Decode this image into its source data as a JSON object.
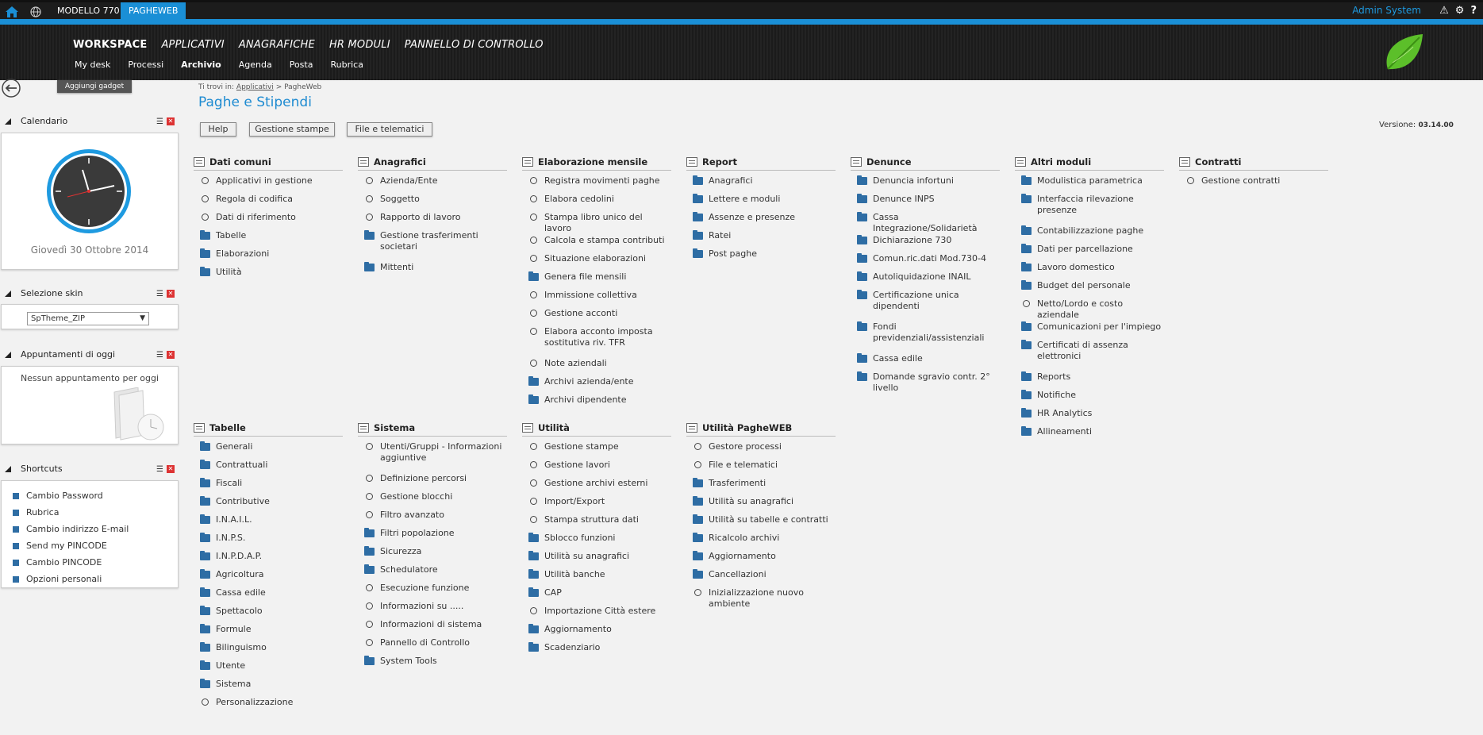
{
  "topbar": {
    "tabs": [
      "MODELLO 770",
      "PAGHEWEB"
    ],
    "user": "Admin System",
    "icons": [
      "home-icon",
      "globe-icon",
      "warning-icon",
      "gear-icon",
      "help-icon"
    ]
  },
  "header": {
    "main_nav": [
      "WORKSPACE",
      "APPLICATIVI",
      "ANAGRAFICHE",
      "HR MODULI",
      "PANNELLO DI CONTROLLO"
    ],
    "sub_nav": [
      "My desk",
      "Processi",
      "Archivio",
      "Agenda",
      "Posta",
      "Rubrica"
    ]
  },
  "sidebar": {
    "add_gadget": "Aggiungi gadget",
    "calendar": {
      "title": "Calendario",
      "date": "Giovedì 30 Ottobre 2014"
    },
    "skin": {
      "title": "Selezione skin",
      "selected": "SpTheme_ZIP"
    },
    "appointments": {
      "title": "Appuntamenti di oggi",
      "empty": "Nessun appuntamento per oggi"
    },
    "shortcuts": {
      "title": "Shortcuts",
      "items": [
        "Cambio Password",
        "Rubrica",
        "Cambio indirizzo E-mail",
        "Send my PINCODE",
        "Cambio PINCODE",
        "Opzioni personali"
      ]
    }
  },
  "main": {
    "breadcrumb": {
      "prefix": "Ti trovi in:",
      "link": "Applicativi",
      "sep": ">",
      "current": "PagheWeb"
    },
    "title": "Paghe e Stipendi",
    "buttons": [
      "Help",
      "Gestione stampe",
      "File e telematici"
    ],
    "version_label": "Versione:",
    "version": "03.14.00",
    "sections_top": [
      {
        "title": "Dati comuni",
        "items": [
          {
            "t": "Applicativi in gestione",
            "k": "c"
          },
          {
            "t": "Regola di codifica",
            "k": "c"
          },
          {
            "t": "Dati di riferimento",
            "k": "c"
          },
          {
            "t": "Tabelle",
            "k": "f"
          },
          {
            "t": "Elaborazioni",
            "k": "f"
          },
          {
            "t": "Utilità",
            "k": "f"
          }
        ]
      },
      {
        "title": "Anagrafici",
        "items": [
          {
            "t": "Azienda/Ente",
            "k": "c"
          },
          {
            "t": "Soggetto",
            "k": "c"
          },
          {
            "t": "Rapporto di lavoro",
            "k": "c"
          },
          {
            "t": "Gestione trasferimenti societari",
            "k": "f"
          },
          {
            "t": "Mittenti",
            "k": "f"
          }
        ]
      },
      {
        "title": "Elaborazione mensile",
        "items": [
          {
            "t": "Registra movimenti paghe",
            "k": "c"
          },
          {
            "t": "Elabora cedolini",
            "k": "c"
          },
          {
            "t": "Stampa libro unico del lavoro",
            "k": "c"
          },
          {
            "t": "Calcola e stampa contributi",
            "k": "c"
          },
          {
            "t": "Situazione elaborazioni",
            "k": "c"
          },
          {
            "t": "Genera file mensili",
            "k": "f"
          },
          {
            "t": "Immissione collettiva",
            "k": "c"
          },
          {
            "t": "Gestione acconti",
            "k": "c"
          },
          {
            "t": "Elabora acconto imposta sostitutiva riv. TFR",
            "k": "c"
          },
          {
            "t": "Note aziendali",
            "k": "c"
          },
          {
            "t": "Archivi azienda/ente",
            "k": "f"
          },
          {
            "t": "Archivi dipendente",
            "k": "f"
          }
        ]
      },
      {
        "title": "Report",
        "items": [
          {
            "t": "Anagrafici",
            "k": "f"
          },
          {
            "t": "Lettere e moduli",
            "k": "f"
          },
          {
            "t": "Assenze e presenze",
            "k": "f"
          },
          {
            "t": "Ratei",
            "k": "f"
          },
          {
            "t": "Post paghe",
            "k": "f"
          }
        ]
      },
      {
        "title": "Denunce",
        "items": [
          {
            "t": "Denuncia infortuni",
            "k": "f"
          },
          {
            "t": "Denunce INPS",
            "k": "f"
          },
          {
            "t": "Cassa Integrazione/Solidarietà",
            "k": "f"
          },
          {
            "t": "Dichiarazione 730",
            "k": "f"
          },
          {
            "t": "Comun.ric.dati Mod.730-4",
            "k": "f"
          },
          {
            "t": "Autoliquidazione INAIL",
            "k": "f"
          },
          {
            "t": "Certificazione unica dipendenti",
            "k": "f"
          },
          {
            "t": "Fondi previdenziali/assistenziali",
            "k": "f"
          },
          {
            "t": "Cassa edile",
            "k": "f"
          },
          {
            "t": "Domande sgravio contr. 2° livello",
            "k": "f"
          }
        ]
      },
      {
        "title": "Altri moduli",
        "items": [
          {
            "t": "Modulistica parametrica",
            "k": "f"
          },
          {
            "t": "Interfaccia rilevazione presenze",
            "k": "f"
          },
          {
            "t": "Contabilizzazione paghe",
            "k": "f"
          },
          {
            "t": "Dati per parcellazione",
            "k": "f"
          },
          {
            "t": "Lavoro domestico",
            "k": "f"
          },
          {
            "t": "Budget del personale",
            "k": "f"
          },
          {
            "t": "Netto/Lordo e costo aziendale",
            "k": "c"
          },
          {
            "t": "Comunicazioni per l'impiego",
            "k": "f"
          },
          {
            "t": "Certificati di assenza elettronici",
            "k": "f"
          },
          {
            "t": "Reports",
            "k": "f"
          },
          {
            "t": "Notifiche",
            "k": "f"
          },
          {
            "t": "HR Analytics",
            "k": "f"
          },
          {
            "t": "Allineamenti",
            "k": "f"
          }
        ]
      },
      {
        "title": "Contratti",
        "items": [
          {
            "t": "Gestione contratti",
            "k": "c"
          }
        ]
      }
    ],
    "sections_bottom": [
      {
        "title": "Tabelle",
        "items": [
          {
            "t": "Generali",
            "k": "f"
          },
          {
            "t": "Contrattuali",
            "k": "f"
          },
          {
            "t": "Fiscali",
            "k": "f"
          },
          {
            "t": "Contributive",
            "k": "f"
          },
          {
            "t": "I.N.A.I.L.",
            "k": "f"
          },
          {
            "t": "I.N.P.S.",
            "k": "f"
          },
          {
            "t": "I.N.P.D.A.P.",
            "k": "f"
          },
          {
            "t": "Agricoltura",
            "k": "f"
          },
          {
            "t": "Cassa edile",
            "k": "f"
          },
          {
            "t": "Spettacolo",
            "k": "f"
          },
          {
            "t": "Formule",
            "k": "f"
          },
          {
            "t": "Bilinguismo",
            "k": "f"
          },
          {
            "t": "Utente",
            "k": "f"
          },
          {
            "t": "Sistema",
            "k": "f"
          },
          {
            "t": "Personalizzazione",
            "k": "c"
          }
        ]
      },
      {
        "title": "Sistema",
        "items": [
          {
            "t": "Utenti/Gruppi - Informazioni aggiuntive",
            "k": "c"
          },
          {
            "t": "Definizione percorsi",
            "k": "c"
          },
          {
            "t": "Gestione blocchi",
            "k": "c"
          },
          {
            "t": "Filtro avanzato",
            "k": "c"
          },
          {
            "t": "Filtri popolazione",
            "k": "f"
          },
          {
            "t": "Sicurezza",
            "k": "f"
          },
          {
            "t": "Schedulatore",
            "k": "f"
          },
          {
            "t": "Esecuzione funzione",
            "k": "c"
          },
          {
            "t": "Informazioni su .....",
            "k": "c"
          },
          {
            "t": "Informazioni di sistema",
            "k": "c"
          },
          {
            "t": "Pannello di Controllo",
            "k": "c"
          },
          {
            "t": "System Tools",
            "k": "f"
          }
        ]
      },
      {
        "title": "Utilità",
        "items": [
          {
            "t": "Gestione stampe",
            "k": "c"
          },
          {
            "t": "Gestione lavori",
            "k": "c"
          },
          {
            "t": "Gestione archivi esterni",
            "k": "c"
          },
          {
            "t": "Import/Export",
            "k": "c"
          },
          {
            "t": "Stampa struttura dati",
            "k": "c"
          },
          {
            "t": "Sblocco funzioni",
            "k": "f"
          },
          {
            "t": "Utilità su anagrafici",
            "k": "f"
          },
          {
            "t": "Utilità banche",
            "k": "f"
          },
          {
            "t": "CAP",
            "k": "f"
          },
          {
            "t": "Importazione Città estere",
            "k": "c"
          },
          {
            "t": "Aggiornamento",
            "k": "f"
          },
          {
            "t": "Scadenziario",
            "k": "f"
          }
        ]
      },
      {
        "title": "Utilità PagheWEB",
        "items": [
          {
            "t": "Gestore processi",
            "k": "c"
          },
          {
            "t": "File e telematici",
            "k": "c"
          },
          {
            "t": "Trasferimenti",
            "k": "f"
          },
          {
            "t": "Utilità su anagrafici",
            "k": "f"
          },
          {
            "t": "Utilità su tabelle e contratti",
            "k": "f"
          },
          {
            "t": "Ricalcolo archivi",
            "k": "f"
          },
          {
            "t": "Aggiornamento",
            "k": "f"
          },
          {
            "t": "Cancellazioni",
            "k": "f"
          },
          {
            "t": "Inizializzazione nuovo ambiente",
            "k": "c"
          }
        ]
      }
    ]
  }
}
